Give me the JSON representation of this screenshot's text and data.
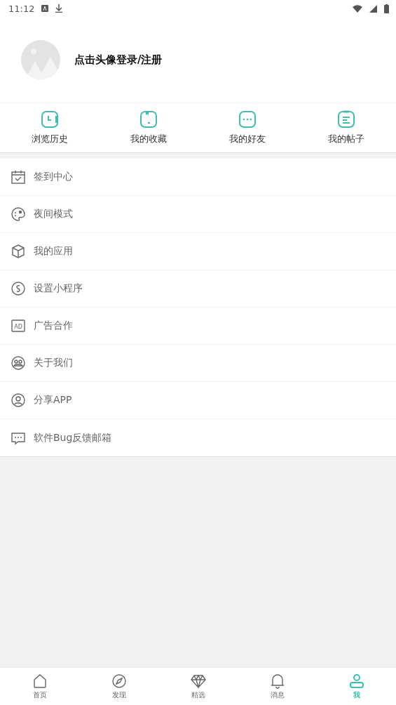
{
  "status_bar": {
    "time": "11:12"
  },
  "profile": {
    "login_prompt": "点击头像登录/注册"
  },
  "shortcuts": [
    {
      "label": "浏览历史"
    },
    {
      "label": "我的收藏"
    },
    {
      "label": "我的好友"
    },
    {
      "label": "我的帖子"
    }
  ],
  "menu": [
    {
      "label": "签到中心"
    },
    {
      "label": "夜间模式"
    },
    {
      "label": "我的应用"
    },
    {
      "label": "设置小程序"
    },
    {
      "label": "广告合作"
    },
    {
      "label": "关于我们"
    },
    {
      "label": "分享APP"
    },
    {
      "label": "软件Bug反馈邮箱"
    }
  ],
  "ad_icon_text": "AD",
  "tab_bar": [
    {
      "label": "首页",
      "selected": false
    },
    {
      "label": "发现",
      "selected": false
    },
    {
      "label": "精选",
      "selected": false
    },
    {
      "label": "消息",
      "selected": false
    },
    {
      "label": "我",
      "selected": true
    }
  ]
}
